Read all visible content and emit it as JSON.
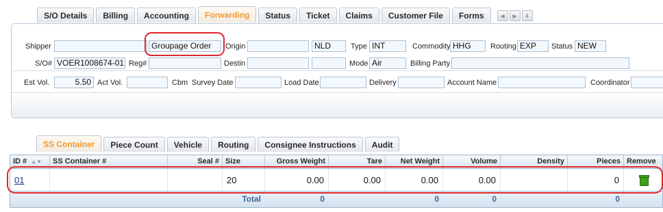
{
  "top_tabs": [
    "S/O Details",
    "Billing",
    "Accounting",
    "Forwarding",
    "Status",
    "Ticket",
    "Claims",
    "Customer File",
    "Forms"
  ],
  "top_tabs_active": "Forwarding",
  "form": {
    "shipper_label": "Shipper",
    "shipper_value": "",
    "shipper2_value": "Groupage Order",
    "origin_label": "Origin",
    "origin_value": "",
    "origin_code": "NLD",
    "type_label": "Type",
    "type_value": "INT",
    "commodity_label": "Commodity",
    "commodity_value": "HHG",
    "routing_label": "Routing",
    "routing_value": "EXP",
    "status_label": "Status",
    "status_value": "NEW",
    "so_label": "S/O#",
    "so_value": "VOER1008674-01",
    "reg_label": "Reg#",
    "reg_value": "",
    "destin_label": "Destin",
    "destin_value": "",
    "destin_code": "",
    "mode_label": "Mode",
    "mode_value": "Air",
    "billing_party_label": "Billing Party",
    "billing_party_value": "",
    "est_vol_label": "Est Vol.",
    "est_vol_value": "5.50",
    "act_vol_label": "Act Vol.",
    "act_vol_value": "",
    "cbm_label": "Cbm",
    "survey_date_label": "Survey Date",
    "survey_date_value": "",
    "load_date_label": "Load Date",
    "load_date_value": "",
    "delivery_label": "Delivery",
    "delivery_value": "",
    "account_name_label": "Account Name",
    "account_name_value": "",
    "coordinator_label": "Coordinator",
    "coordinator_value": ""
  },
  "bottom_tabs": [
    "SS Container",
    "Piece Count",
    "Vehicle",
    "Routing",
    "Consignee Instructions",
    "Audit"
  ],
  "bottom_tabs_active": "SS Container",
  "grid": {
    "headers": {
      "id": "ID #",
      "ss_container": "SS Container #",
      "seal": "Seal #",
      "size": "Size",
      "gross_weight": "Gross Weight",
      "tare": "Tare",
      "net_weight": "Net Weight",
      "volume": "Volume",
      "density": "Density",
      "pieces": "Pieces",
      "remove": "Remove"
    },
    "row": {
      "id": "01",
      "ss_container": "",
      "seal": "",
      "size": "20",
      "gross_weight": "0.00",
      "tare": "0.00",
      "net_weight": "0.00",
      "volume": "0.00",
      "density": "",
      "pieces": "0"
    },
    "totals": {
      "label": "Total",
      "gross_weight": "0",
      "net_weight": "0",
      "volume": "0",
      "pieces": "0"
    }
  },
  "colors": {
    "active_tab": "#f39a34",
    "highlight": "#e0262c",
    "field_border": "#a9bfd3",
    "total_text": "#3b6a9a"
  }
}
